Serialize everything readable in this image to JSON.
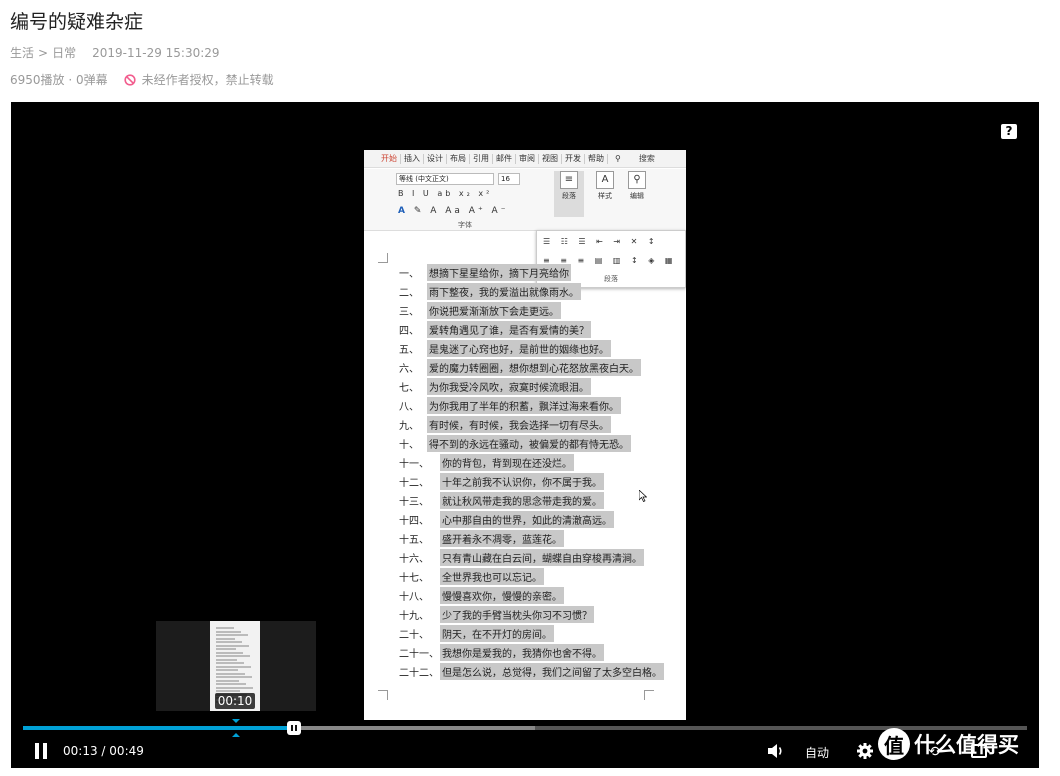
{
  "title": "编号的疑难杂症",
  "breadcrumb": {
    "category": "生活",
    "separator": ">",
    "subcategory": "日常"
  },
  "publish_time": "2019-11-29 15:30:29",
  "stats": "6950播放 · 0弹幕",
  "copyright_notice": "未经作者授权，禁止转载",
  "player": {
    "help_label": "?",
    "current_time": "00:13",
    "time_separator": "/",
    "duration": "00:49",
    "progress": 0.27,
    "buffered": 0.51,
    "quality_label": "自动",
    "preview_time": "00:10",
    "watermark": "什么值得买",
    "watermark_logo": "值"
  },
  "video_frame": {
    "ribbon_tabs": [
      "开始",
      "插入",
      "设计",
      "布局",
      "引用",
      "邮件",
      "审阅",
      "视图",
      "开发",
      "帮助"
    ],
    "search_label": "搜索",
    "font_name": "等线 (中文正文)",
    "font_size": "16",
    "font_group_label": "字体",
    "paragraph_button": "段落",
    "style_button": "样式",
    "edit_button": "编辑",
    "paragraph_popup_label": "段落",
    "lines": [
      {
        "num": "一、",
        "text": "想摘下星星给你，摘下月亮给你"
      },
      {
        "num": "二、",
        "text": "雨下整夜，我的爱溢出就像雨水。"
      },
      {
        "num": "三、",
        "text": "你说把爱渐渐放下会走更远。"
      },
      {
        "num": "四、",
        "text": "爱转角遇见了谁，是否有爱情的美？"
      },
      {
        "num": "五、",
        "text": "是鬼迷了心窍也好，是前世的姻缘也好。"
      },
      {
        "num": "六、",
        "text": "爱的魔力转圈圈，想你想到心花怒放黑夜白天。"
      },
      {
        "num": "七、",
        "text": "为你我受冷风吹，寂寞时候流眼泪。"
      },
      {
        "num": "八、",
        "text": "为你我用了半年的积蓄，飘洋过海来看你。"
      },
      {
        "num": "九、",
        "text": "有时候，有时候，我会选择一切有尽头。"
      },
      {
        "num": "十、",
        "text": "得不到的永远在骚动，被偏爱的都有恃无恐。"
      },
      {
        "num": "十一、",
        "text": "你的背包，背到现在还没烂。"
      },
      {
        "num": "十二、",
        "text": "十年之前我不认识你，你不属于我。"
      },
      {
        "num": "十三、",
        "text": "就让秋风带走我的思念带走我的爱。"
      },
      {
        "num": "十四、",
        "text": "心中那自由的世界，如此的清澈高远。"
      },
      {
        "num": "十五、",
        "text": "盛开着永不凋零，蓝莲花。"
      },
      {
        "num": "十六、",
        "text": "只有青山藏在白云间，蝴蝶自由穿梭再清涧。"
      },
      {
        "num": "十七、",
        "text": "全世界我也可以忘记。"
      },
      {
        "num": "十八、",
        "text": "慢慢喜欢你，慢慢的亲密。"
      },
      {
        "num": "十九、",
        "text": "少了我的手臂当枕头你习不习惯？"
      },
      {
        "num": "二十、",
        "text": "阴天，在不开灯的房间。"
      },
      {
        "num": "二十一、",
        "text": "我想你是爱我的，我猜你也舍不得。"
      },
      {
        "num": "二十二、",
        "text": "但是怎么说，总觉得，我们之间留了太多空白格。"
      }
    ]
  },
  "colors": {
    "accent": "#00a1d6",
    "ban": "#f25d8e"
  },
  "icons": [
    "ban-icon",
    "help-icon",
    "pause-icon",
    "volume-icon",
    "gear-icon",
    "loop-icon",
    "fullscreen-icon"
  ]
}
